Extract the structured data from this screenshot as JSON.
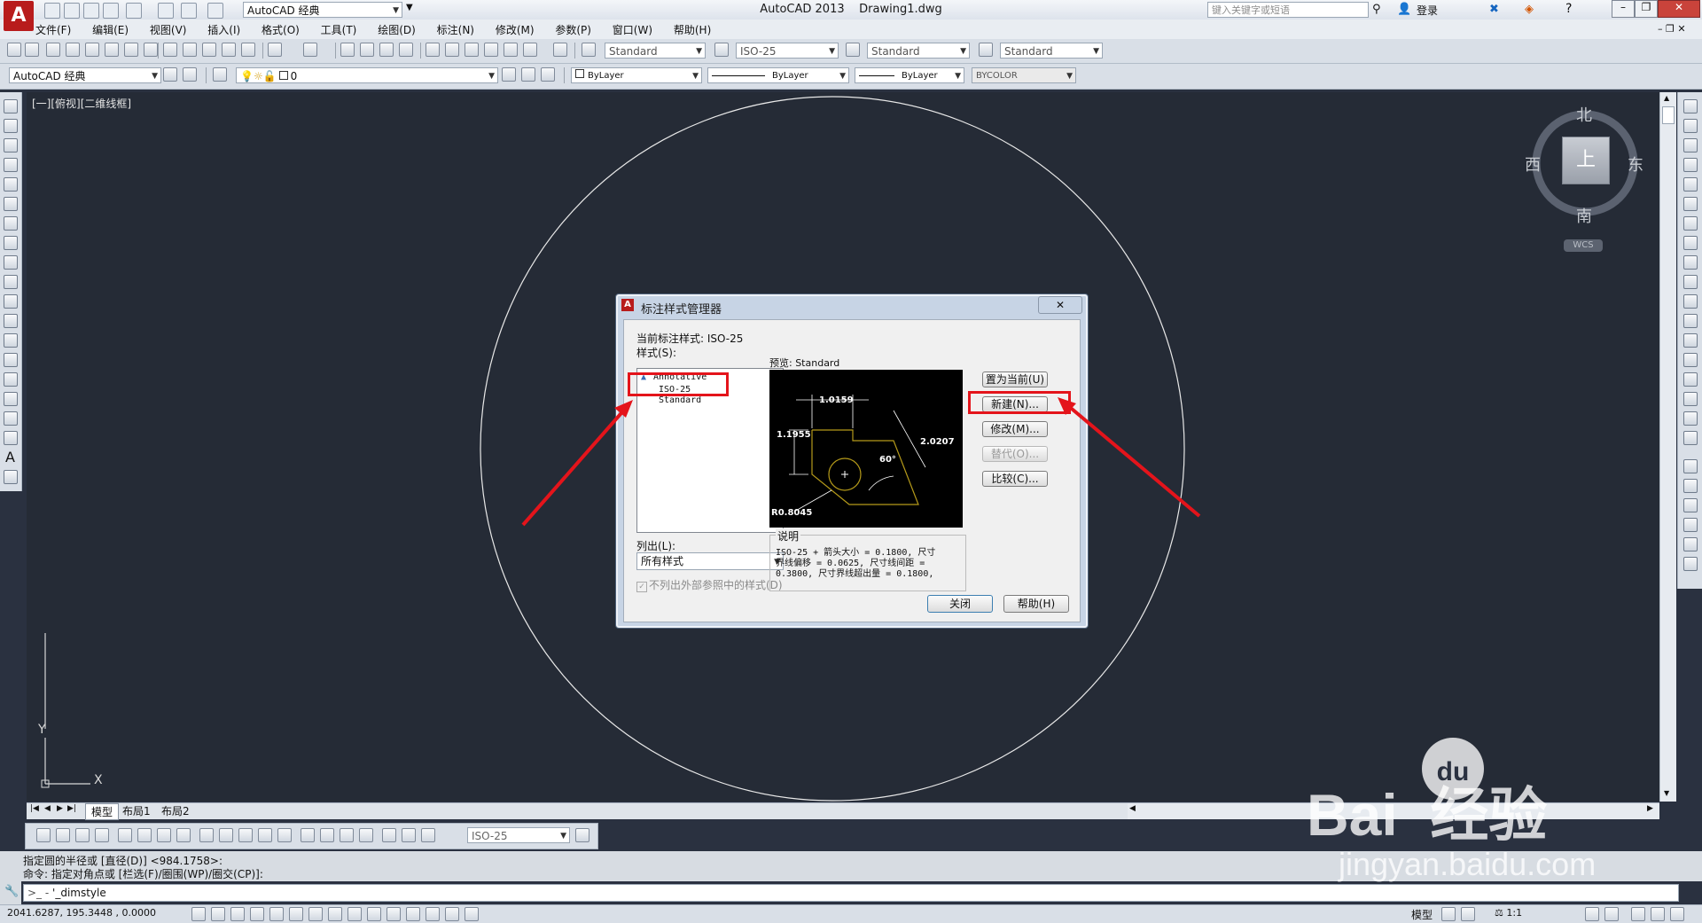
{
  "titlebar": {
    "workspace": "AutoCAD 经典",
    "app_title": "AutoCAD 2013",
    "doc_title": "Drawing1.dwg",
    "search_placeholder": "键入关键字或短语",
    "login": "登录"
  },
  "menu": [
    "文件(F)",
    "编辑(E)",
    "视图(V)",
    "插入(I)",
    "格式(O)",
    "工具(T)",
    "绘图(D)",
    "标注(N)",
    "修改(M)",
    "参数(P)",
    "窗口(W)",
    "帮助(H)"
  ],
  "styles_toolbar": {
    "text_style": "Standard",
    "dim_style": "ISO-25",
    "table_style": "Standard",
    "mleader_style": "Standard"
  },
  "layers_toolbar": {
    "workspace": "AutoCAD 经典",
    "layer": "0",
    "color": "ByLayer",
    "linetype": "ByLayer",
    "lineweight": "ByLayer",
    "plotstyle": "BYCOLOR"
  },
  "viewport": {
    "label": "[一][俯视][二维线框]",
    "compass": {
      "north": "北",
      "south": "南",
      "east": "东",
      "west": "西",
      "top": "上"
    },
    "wcs": "WCS",
    "ucs_x": "X",
    "ucs_y": "Y"
  },
  "tabs": [
    "模型",
    "布局1",
    "布局2"
  ],
  "dim_toolbar": {
    "dim_style": "ISO-25"
  },
  "command": {
    "history_1": "指定圆的半径或 [直径(D)] <984.1758>:",
    "history_2": "命令: 指定对角点或 [栏选(F)/圈围(WP)/圈交(CP)]:",
    "input": "'_dimstyle"
  },
  "statusbar": {
    "coords": "2041.6287, 195.3448 , 0.0000",
    "model": "模型",
    "scale": "1:1"
  },
  "dialog": {
    "title": "标注样式管理器",
    "close_x": "✕",
    "current_style_label": "当前标注样式: ISO-25",
    "styles_label": "样式(S):",
    "styles": [
      "Annotative",
      "ISO-25",
      "Standard"
    ],
    "preview_label": "预览: Standard",
    "list_label": "列出(L):",
    "list_value": "所有样式",
    "xref_checkbox": "不列出外部参照中的样式(D)",
    "buttons": {
      "set_current": "置为当前(U)",
      "new": "新建(N)...",
      "modify": "修改(M)...",
      "override": "替代(O)...",
      "compare": "比较(C)..."
    },
    "description_label": "说明",
    "description": [
      "ISO-25 + 箭头大小 = 0.1800, 尺寸",
      "界线偏移 = 0.0625, 尺寸线间距 =",
      "0.3800, 尺寸界线超出量 = 0.1800,"
    ],
    "close_button": "关闭",
    "help_button": "帮助(H)",
    "preview_dims": {
      "top": "1.0159",
      "left": "1.1955",
      "right": "2.0207",
      "angle": "60°",
      "radius": "R0.8045"
    }
  },
  "watermark": {
    "brand": "Bai  经验",
    "du_logo": "du",
    "url": "jingyan.baidu.com"
  },
  "colors": {
    "drawing_bg": "#252b36",
    "annotation_red": "#e4141b",
    "preview_yellow": "#b59a1a"
  }
}
